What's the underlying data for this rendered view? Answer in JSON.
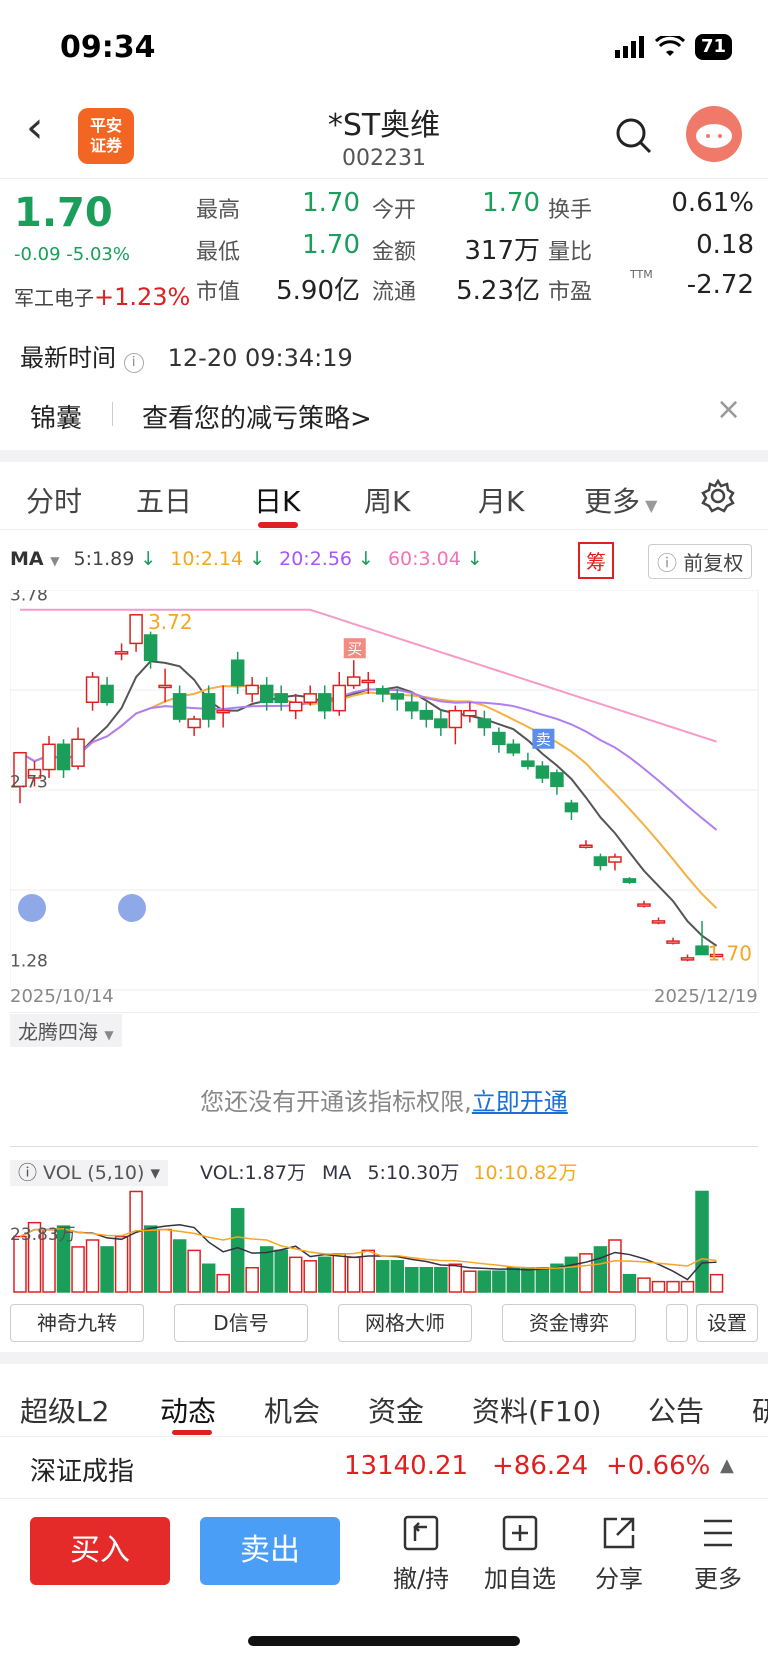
{
  "status": {
    "time": "09:34",
    "battery": "71"
  },
  "header": {
    "logo_l1": "平安",
    "logo_l2": "证券",
    "name": "*ST奥维",
    "code": "002231"
  },
  "quote": {
    "price": "1.70",
    "change": "-0.09 -5.03%",
    "sector_name": "军工电子",
    "sector_chg": "+1.23%",
    "fields": [
      {
        "label": "最高",
        "value": "1.70"
      },
      {
        "label": "今开",
        "value": "1.70"
      },
      {
        "label": "换手",
        "value": "0.61%"
      },
      {
        "label": "最低",
        "value": "1.70"
      },
      {
        "label": "金额",
        "value": "317万"
      },
      {
        "label": "量比",
        "value": "0.18"
      },
      {
        "label": "市值",
        "value": "5.90亿"
      },
      {
        "label": "流通",
        "value": "5.23亿"
      },
      {
        "label": "市盈",
        "value": "-2.72"
      }
    ],
    "ttm": "TTM"
  },
  "latest": {
    "label": "最新时间",
    "value": "12-20 09:34:19"
  },
  "tip": {
    "tag": "锦囊",
    "text": "查看您的减亏策略>"
  },
  "tabs": [
    "分时",
    "五日",
    "日K",
    "周K",
    "月K",
    "更多"
  ],
  "ma": {
    "label": "MA",
    "ma5": "5:1.89",
    "ma10": "10:2.14",
    "ma20": "20:2.56",
    "ma60": "60:3.04",
    "chip": "筹",
    "fq": "前复权"
  },
  "chart_data": {
    "type": "candlestick",
    "y_ticks": [
      "3.78",
      "2.73",
      "1.28"
    ],
    "x_start": "2025/10/14",
    "x_end": "2025/12/19",
    "max_label": "3.72",
    "last_label": "1.70",
    "buy_marker": "买",
    "sell_marker": "卖",
    "candles": [
      [
        2.7,
        2.9,
        2.9,
        2.6
      ],
      [
        2.75,
        2.8,
        2.85,
        2.7
      ],
      [
        2.8,
        2.95,
        3.0,
        2.75
      ],
      [
        2.95,
        2.8,
        2.98,
        2.75
      ],
      [
        2.82,
        2.98,
        3.05,
        2.8
      ],
      [
        3.2,
        3.35,
        3.38,
        3.15
      ],
      [
        3.3,
        3.2,
        3.35,
        3.18
      ],
      [
        3.5,
        3.5,
        3.55,
        3.45
      ],
      [
        3.55,
        3.72,
        3.72,
        3.5
      ],
      [
        3.6,
        3.45,
        3.62,
        3.4
      ],
      [
        3.3,
        3.3,
        3.4,
        3.2
      ],
      [
        3.25,
        3.1,
        3.3,
        3.08
      ],
      [
        3.05,
        3.1,
        3.12,
        3.0
      ],
      [
        3.25,
        3.1,
        3.3,
        3.05
      ],
      [
        3.15,
        3.15,
        3.3,
        3.05
      ],
      [
        3.45,
        3.3,
        3.5,
        3.25
      ],
      [
        3.25,
        3.3,
        3.35,
        3.2
      ],
      [
        3.3,
        3.2,
        3.35,
        3.15
      ],
      [
        3.25,
        3.2,
        3.3,
        3.15
      ],
      [
        3.15,
        3.2,
        3.25,
        3.1
      ],
      [
        3.2,
        3.25,
        3.3,
        3.18
      ],
      [
        3.25,
        3.15,
        3.3,
        3.1
      ],
      [
        3.15,
        3.3,
        3.38,
        3.12
      ],
      [
        3.3,
        3.35,
        3.45,
        3.28
      ],
      [
        3.33,
        3.33,
        3.38,
        3.25
      ],
      [
        3.28,
        3.25,
        3.3,
        3.2
      ],
      [
        3.25,
        3.22,
        3.28,
        3.15
      ],
      [
        3.2,
        3.15,
        3.25,
        3.1
      ],
      [
        3.15,
        3.1,
        3.2,
        3.05
      ],
      [
        3.1,
        3.05,
        3.15,
        3.0
      ],
      [
        3.05,
        3.15,
        3.18,
        2.95
      ],
      [
        3.12,
        3.15,
        3.2,
        3.08
      ],
      [
        3.1,
        3.05,
        3.15,
        3.0
      ],
      [
        3.02,
        2.95,
        3.05,
        2.9
      ],
      [
        2.95,
        2.9,
        2.98,
        2.88
      ],
      [
        2.85,
        2.82,
        2.9,
        2.8
      ],
      [
        2.82,
        2.75,
        2.85,
        2.72
      ],
      [
        2.78,
        2.7,
        2.8,
        2.65
      ],
      [
        2.6,
        2.55,
        2.62,
        2.5
      ],
      [
        2.35,
        2.35,
        2.38,
        2.33
      ],
      [
        2.28,
        2.23,
        2.3,
        2.2
      ],
      [
        2.25,
        2.28,
        2.3,
        2.2
      ],
      [
        2.15,
        2.13,
        2.16,
        2.12
      ],
      [
        2.0,
        2.0,
        2.02,
        1.98
      ],
      [
        1.9,
        1.9,
        1.92,
        1.88
      ],
      [
        1.78,
        1.78,
        1.8,
        1.76
      ],
      [
        1.68,
        1.68,
        1.7,
        1.66
      ],
      [
        1.75,
        1.7,
        1.9,
        1.7
      ],
      [
        1.7,
        1.7,
        1.7,
        1.7
      ]
    ],
    "vol_values": [
      1.6,
      2.0,
      1.8,
      1.9,
      1.3,
      1.5,
      1.3,
      1.6,
      2.9,
      1.9,
      1.8,
      1.5,
      1.2,
      0.8,
      0.5,
      2.4,
      0.7,
      1.3,
      1.2,
      1.0,
      0.9,
      1.0,
      1.1,
      1.0,
      1.2,
      0.9,
      0.9,
      0.7,
      0.7,
      0.7,
      0.8,
      0.6,
      0.6,
      0.6,
      0.7,
      0.7,
      0.7,
      0.8,
      1.0,
      1.1,
      1.3,
      1.5,
      0.5,
      0.4,
      0.3,
      0.3,
      0.3,
      2.9,
      0.5
    ]
  },
  "indicator": {
    "name": "龙腾四海",
    "lock_text": "您还没有开通该指标权限,",
    "link": "立即开通"
  },
  "vol": {
    "label": "VOL (5,10)",
    "vol": "VOL:1.87万",
    "ma": "MA",
    "ma5": "5:10.30万",
    "ma10": "10:10.82万",
    "ytick": "23.83万"
  },
  "ind_buttons": [
    "神奇九转",
    "D信号",
    "网格大师",
    "资金博弈",
    "设置"
  ],
  "bottom_tabs": [
    "超级L2",
    "动态",
    "机会",
    "资金",
    "资料(F10)",
    "公告",
    "研"
  ],
  "index": {
    "name": "深证成指",
    "value": "13140.21",
    "chg": "+86.24",
    "pct": "+0.66%"
  },
  "footer": {
    "buy": "买入",
    "sell": "卖出",
    "btns": [
      "撤/持",
      "加自选",
      "分享",
      "更多"
    ]
  }
}
